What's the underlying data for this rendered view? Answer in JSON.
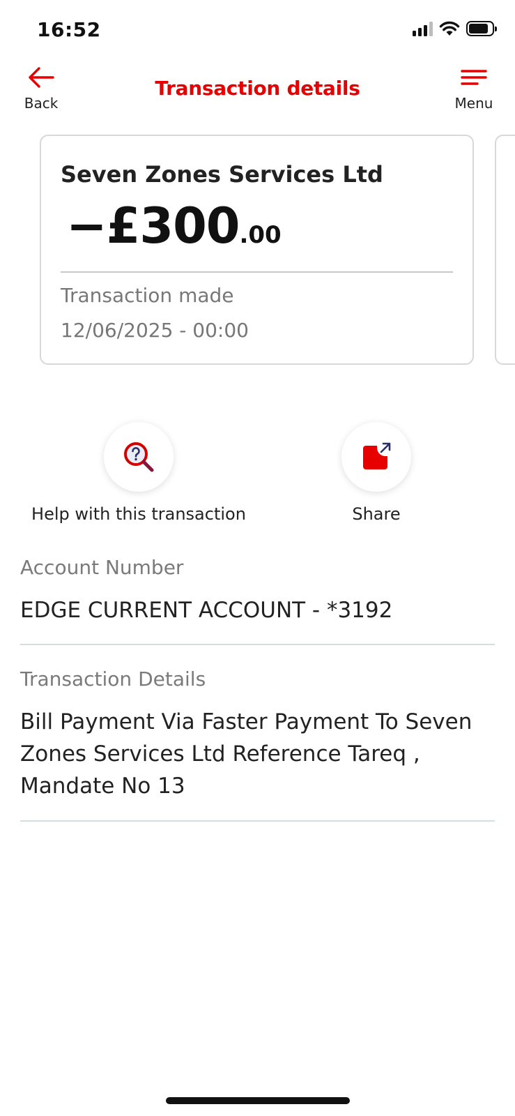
{
  "status_bar": {
    "time": "16:52"
  },
  "header": {
    "back_label": "Back",
    "title": "Transaction details",
    "menu_label": "Menu"
  },
  "transaction": {
    "merchant": "Seven Zones Services Ltd",
    "amount_major": "−£300",
    "amount_minor": ".00",
    "made_label": "Transaction made",
    "made_date": "12/06/2025 - 00:00"
  },
  "actions": {
    "help_label": "Help with this transaction",
    "share_label": "Share"
  },
  "details": {
    "account_label": "Account Number",
    "account_value": "EDGE CURRENT ACCOUNT - *3192",
    "transaction_label": "Transaction Details",
    "transaction_value": "Bill Payment Via Faster Payment To Seven Zones Services Ltd Reference Tareq , Mandate No 13"
  },
  "icons": {
    "back": "arrow-left-icon",
    "menu": "hamburger-menu-icon",
    "help": "magnifier-question-icon",
    "share": "share-icon"
  },
  "colors": {
    "brand_red": "#e60000",
    "text_primary": "#222222",
    "text_muted": "#777777",
    "divider": "#d4dde6"
  }
}
